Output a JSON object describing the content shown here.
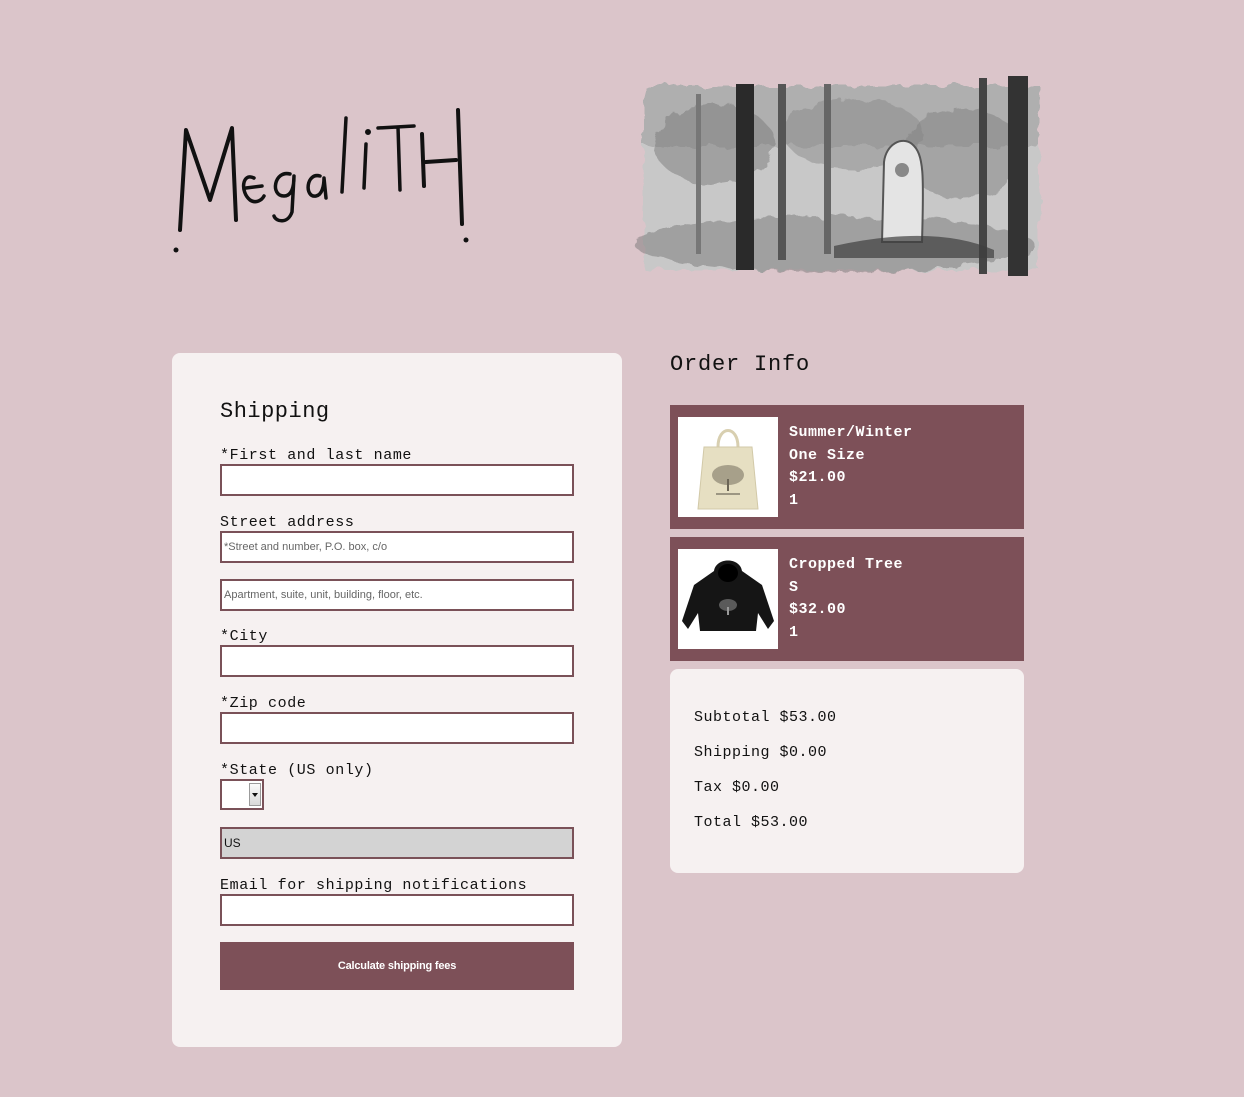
{
  "brand": {
    "logo_text": "Megalith"
  },
  "shipping": {
    "title": "Shipping",
    "name_label": "*First and last name",
    "name_value": "",
    "street_label": "Street address",
    "street1_placeholder": "*Street and number, P.O. box, c/o",
    "street2_placeholder": "Apartment, suite, unit, building, floor, etc.",
    "city_label": "*City",
    "zip_label": "*Zip code",
    "state_label": "*State (US only)",
    "state_value": "",
    "country_value": "US",
    "email_label": "Email for shipping notifications",
    "calc_button_label": "Calculate shipping fees"
  },
  "order": {
    "title": "Order Info",
    "items": [
      {
        "name": "Summer/Winter",
        "variant": "One Size",
        "price": "$21.00",
        "quantity": "1",
        "thumbnail": "tote-bag-image"
      },
      {
        "name": "Cropped Tree",
        "variant": "S",
        "price": "$32.00",
        "quantity": "1",
        "thumbnail": "hoodie-image"
      }
    ],
    "totals": {
      "subtotal": "Subtotal $53.00",
      "shipping": "Shipping $0.00",
      "tax": "Tax $0.00",
      "total": "Total $53.00"
    }
  },
  "colors": {
    "background": "#dbc5ca",
    "card": "#f6f1f1",
    "accent": "#7d5058",
    "input_border": "#7a5158"
  }
}
